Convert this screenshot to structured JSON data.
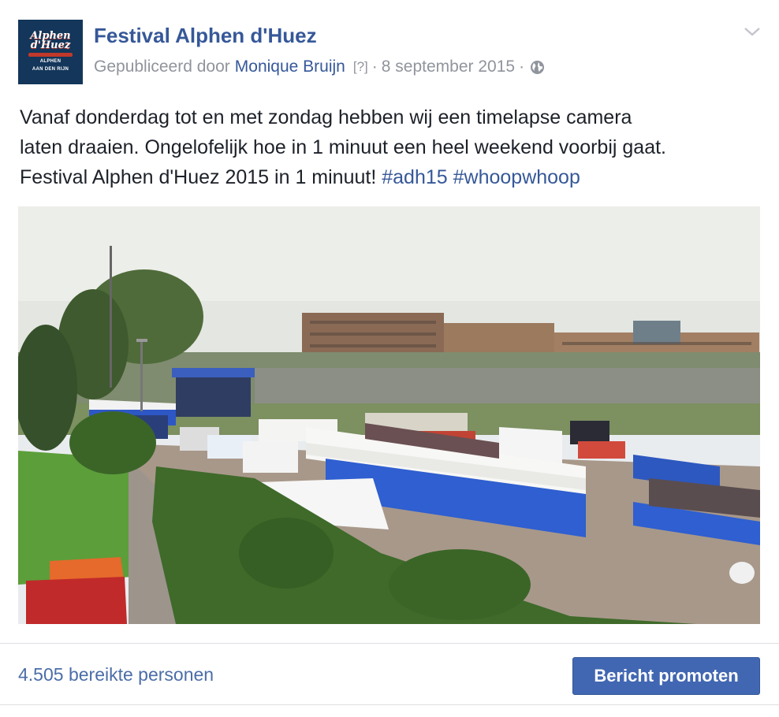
{
  "post": {
    "page_name": "Festival Alphen d'Huez",
    "avatar": {
      "logo_line1": "Alphen",
      "logo_line2": "d'Huez",
      "logo_sub1": "ALPHEN",
      "logo_sub2": "AAN DEN RIJN"
    },
    "meta": {
      "published_by": "Gepubliceerd door",
      "author": "Monique Bruijn",
      "question": "[?]",
      "separator": "·",
      "date": "8 september 2015",
      "audience_icon": "globe-icon"
    },
    "menu_icon": "chevron-down-icon",
    "text": {
      "line1": "Vanaf donderdag tot en met zondag hebben wij een timelapse camera",
      "line2": "laten draaien. Ongelofelijk hoe in 1 minuut een heel weekend voorbij gaat.",
      "line3_text": "Festival Alphen d'Huez 2015 in 1 minuut!",
      "hashtags": [
        "#adh15",
        "#whoopwhoop"
      ]
    },
    "media": {
      "type": "video-still",
      "alt": "Timelapse festival grounds"
    }
  },
  "footer": {
    "reach_text": "4.505 bereikte personen",
    "promote_label": "Bericht promoten"
  },
  "colors": {
    "link": "#365899",
    "meta": "#90949c",
    "button": "#4267b2",
    "text": "#1d2129"
  }
}
